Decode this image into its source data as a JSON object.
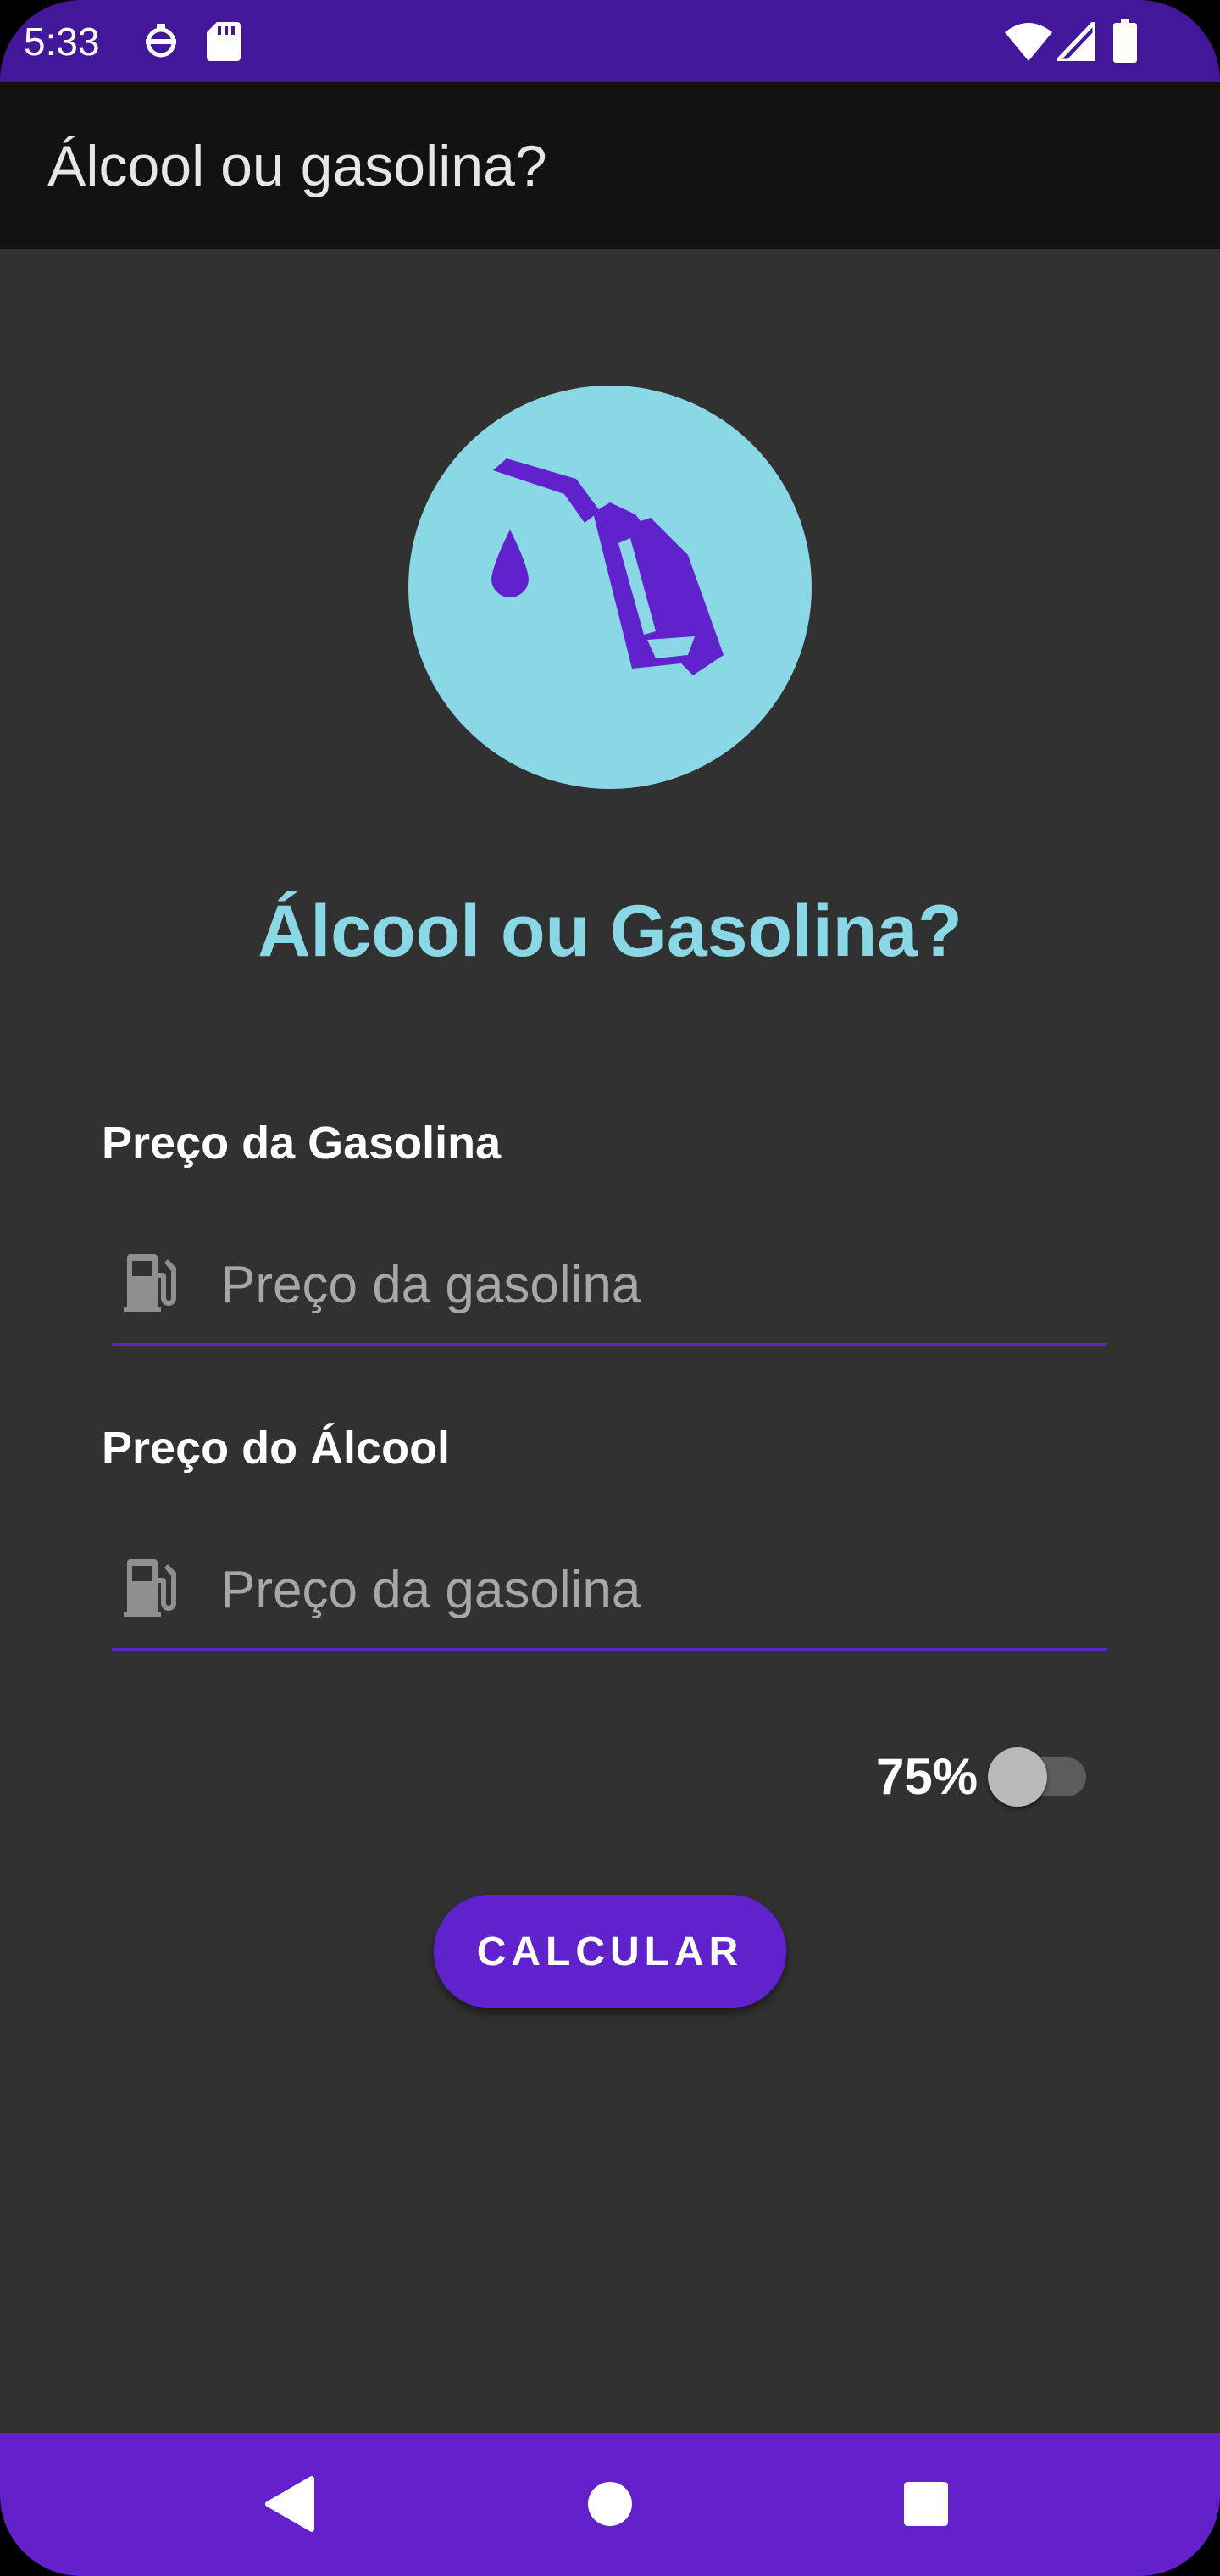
{
  "status_bar": {
    "time": "5:33",
    "icons": [
      "face-detect-icon",
      "sd-card-icon",
      "wifi-icon",
      "signal-icon",
      "battery-icon"
    ]
  },
  "app_bar": {
    "title": "Álcool ou gasolina?"
  },
  "main": {
    "logo_icon": "fuel-nozzle-icon",
    "heading": "Álcool ou Gasolina?",
    "gasoline_field": {
      "label": "Preço da Gasolina",
      "placeholder": "Preço da gasolina",
      "value": "",
      "icon": "gas-pump-icon"
    },
    "alcohol_field": {
      "label": "Preço do Álcool",
      "placeholder": "Preço da gasolina",
      "value": "",
      "icon": "gas-pump-icon"
    },
    "ratio_switch": {
      "label": "75%",
      "checked": false
    },
    "calculate_button": "CALCULAR"
  },
  "nav_bar": {
    "buttons": [
      "back-icon",
      "home-icon",
      "recents-icon"
    ]
  },
  "colors": {
    "status_bar": "#421799",
    "app_bar": "#121212",
    "background": "#313131",
    "accent": "#6022cc",
    "logo_circle": "#8ad8e5",
    "heading": "#8ad8e5"
  }
}
